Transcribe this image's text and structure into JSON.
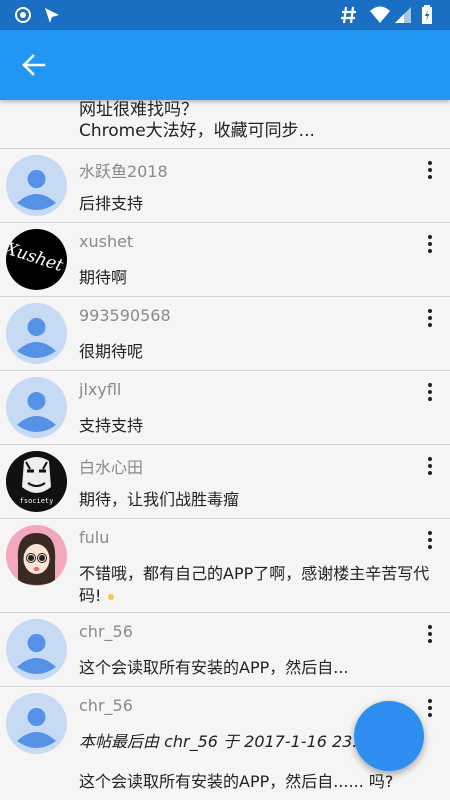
{
  "status_bar": {
    "icons": [
      "camera-record-icon",
      "send-icon",
      "hash-icon",
      "wifi-icon",
      "signal-icon",
      "battery-icon"
    ],
    "color": "#1a6fc2"
  },
  "app_bar": {
    "back_icon": "arrow-left-icon",
    "color": "#2196f3"
  },
  "list": {
    "previous_item": {
      "line1": "网址很难找吗？",
      "line2": "Chrome大法好，收藏可同步..."
    },
    "comments": [
      {
        "name": "水跃鱼2018",
        "text": "后排支持",
        "avatar": "default-avatar"
      },
      {
        "name": "xushet",
        "text": "期待啊",
        "avatar": "xushet-avatar",
        "avatar_text": "Xushet"
      },
      {
        "name": "993590568",
        "text": "很期待呢",
        "avatar": "default-avatar"
      },
      {
        "name": "jlxyfll",
        "text": "支持支持",
        "avatar": "default-avatar"
      },
      {
        "name": "白水心田",
        "text": "期待，让我们战胜毒瘤",
        "avatar": "fsociety-avatar",
        "avatar_text": "fsociety"
      },
      {
        "name": "fulu",
        "text": "不错哦，都有自己的APP了啊，感谢楼主辛苦写代码!",
        "avatar": "girl-avatar"
      },
      {
        "name": "chr_56",
        "text": "这个会读取所有安装的APP，然后自...",
        "avatar": "default-avatar"
      },
      {
        "name": "chr_56",
        "text": "本帖最后由 chr_56 于 2017-1-16 23:1",
        "text2": "这个会读取所有安装的APP，然后自...... 吗?",
        "avatar": "default-avatar"
      }
    ]
  },
  "fab": {
    "color": "#2d8ef0"
  }
}
